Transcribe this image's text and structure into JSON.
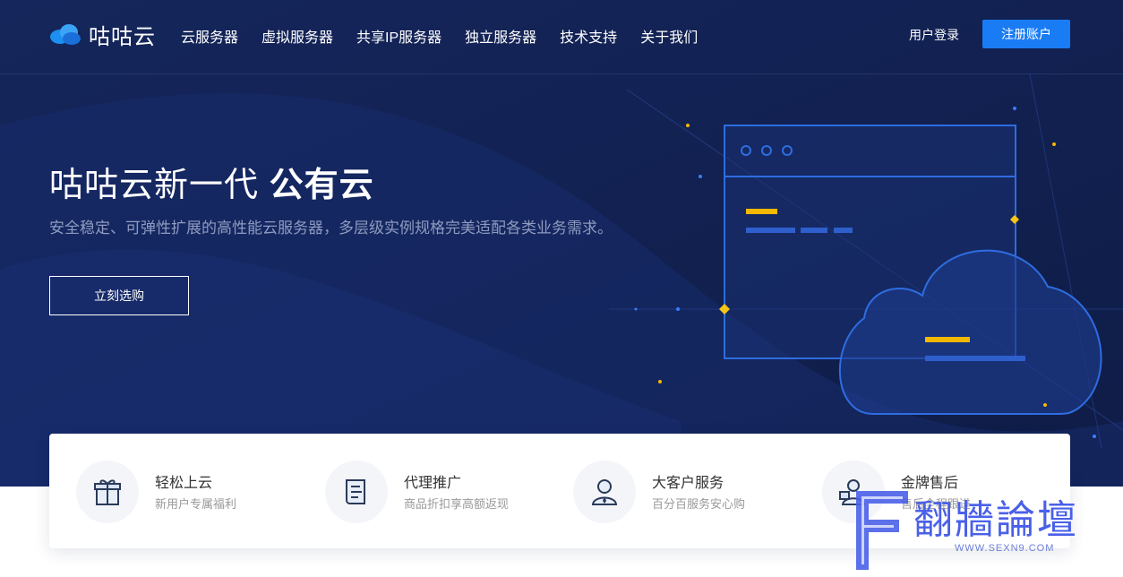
{
  "brand": {
    "name": "咕咕云"
  },
  "nav": {
    "items": [
      "云服务器",
      "虚拟服务器",
      "共享IP服务器",
      "独立服务器",
      "技术支持",
      "关于我们"
    ],
    "login": "用户登录",
    "register": "注册账户"
  },
  "hero": {
    "title_main": "咕咕云新一代 ",
    "title_bold": "公有云",
    "subtitle": "安全稳定、可弹性扩展的高性能云服务器，多层级实例规格完美适配各类业务需求。",
    "button": "立刻选购"
  },
  "features": [
    {
      "title": "轻松上云",
      "desc": "新用户专属福利",
      "icon": "gift-icon"
    },
    {
      "title": "代理推广",
      "desc": "商品折扣享高额返现",
      "icon": "document-icon"
    },
    {
      "title": "大客户服务",
      "desc": "百分百服务安心购",
      "icon": "user-icon"
    },
    {
      "title": "金牌售后",
      "desc": "售后全程跟进",
      "icon": "service-icon"
    }
  ],
  "watermark": {
    "text": "翻牆論壇",
    "url": "WWW.SEXN9.COM"
  },
  "colors": {
    "hero_bg": "#132255",
    "accent": "#1a7cf5",
    "highlight": "#f5b800",
    "line": "#2e6de0"
  }
}
